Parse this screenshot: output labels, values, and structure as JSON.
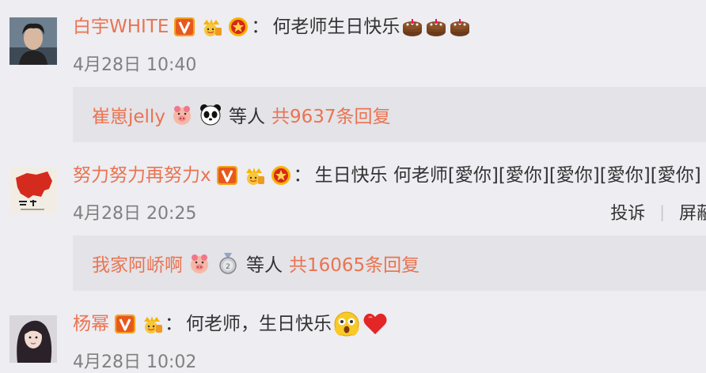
{
  "comments": [
    {
      "username": "白宇WHITE",
      "text": "何老师生日快乐",
      "time": "4月28日 10:40",
      "emojis": [
        "cake-emoji",
        "cake-emoji",
        "cake-emoji"
      ],
      "reply": {
        "name": "崔崽jelly",
        "deng": "等人",
        "count": "共9637条回复",
        "icons": [
          "pig-badge-icon",
          "panda-icon"
        ]
      }
    },
    {
      "username": "努力努力再努力x",
      "text": "生日快乐 何老师[愛你][愛你][愛你][愛你][愛你]",
      "time": "4月28日 20:25",
      "actions": {
        "report": "投诉",
        "block": "屏蔽"
      },
      "reply": {
        "name": "我家阿峤啊",
        "deng": "等人",
        "count": "共16065条回复",
        "icons": [
          "pig-badge-icon",
          "silver-medal-icon"
        ]
      }
    },
    {
      "username": "杨幂",
      "text": "何老师，生日快乐",
      "time": "4月28日 10:02",
      "emojis": [
        "shocked-face-emoji",
        "red-heart-emoji"
      ]
    }
  ],
  "colors": {
    "username": "#eb7350",
    "background": "#ededf2",
    "reply_bg": "#e3e3e8",
    "time": "#808080"
  },
  "badges": [
    "verified-v-icon",
    "gold-fan-icon",
    "red-star-badge-icon"
  ]
}
